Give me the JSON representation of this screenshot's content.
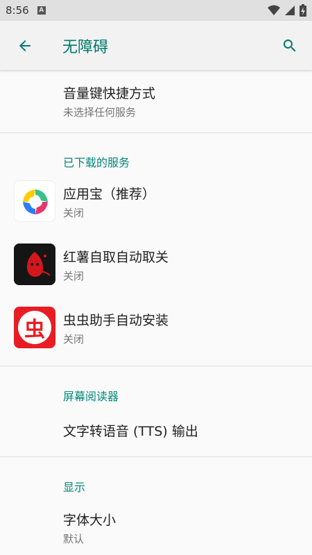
{
  "status": {
    "time": "8:56",
    "notif": "A"
  },
  "app_bar": {
    "title": "无障碍"
  },
  "shortcut": {
    "title": "音量键快捷方式",
    "subtitle": "未选择任何服务"
  },
  "sections": {
    "downloaded": "已下载的服务",
    "screen_reader": "屏幕阅读器",
    "display": "显示"
  },
  "services": [
    {
      "name": "应用宝（推荐）",
      "status": "关闭"
    },
    {
      "name": "红薯自取自动取关",
      "status": "关闭"
    },
    {
      "name": "虫虫助手自动安装",
      "status": "关闭"
    }
  ],
  "tts": {
    "title": "文字转语音 (TTS) 输出"
  },
  "font_size": {
    "title": "字体大小",
    "subtitle": "默认"
  },
  "icons": {
    "app3_char": "虫"
  }
}
